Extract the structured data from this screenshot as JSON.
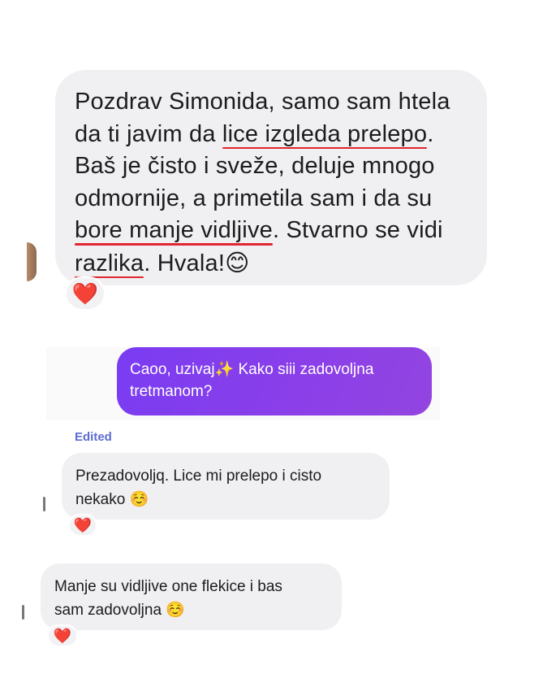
{
  "messages": {
    "first": {
      "lines": [
        {
          "pre": "Pozdrav Simonida, samo sam htela",
          "u": "",
          "post": ""
        },
        {
          "pre": "da ti javim da ",
          "u": "lice izgleda prelepo",
          "post": "."
        },
        {
          "pre": "Baš je čisto i sveže, deluje mnogo",
          "u": "",
          "post": ""
        },
        {
          "pre": "odmornije, a primetila sam i da su",
          "u": "",
          "post": ""
        },
        {
          "pre": "",
          "u": "bore manje vidljive",
          "post": ". Stvarno se vidi"
        },
        {
          "pre": "",
          "u": "razlika",
          "post": ". Hvala!"
        }
      ],
      "emoji": "😊",
      "reaction": "❤️"
    },
    "outgoing": {
      "line1_pre": "Caoo, uzivaj",
      "sparkle": "✨",
      "line1_post": " Kako siii zadovoljna",
      "line2": "tretmanom?"
    },
    "edited_label": "Edited",
    "second": {
      "line1": "Prezadovoljq. Lice mi prelepo i  cisto",
      "line2": "nekako",
      "emoji": "☺️",
      "reaction": "❤️"
    },
    "third": {
      "line1": "Manje su vidljive one flekice i bas",
      "line2": "sam zadovoljna",
      "emoji": "☺️",
      "reaction": "❤️"
    }
  },
  "colors": {
    "incoming_bubble": "#f0f0f2",
    "outgoing_gradient_start": "#7a3cf2",
    "outgoing_gradient_end": "#9245e0",
    "underline": "#e0262e",
    "edited_label": "#5c6bd1"
  }
}
